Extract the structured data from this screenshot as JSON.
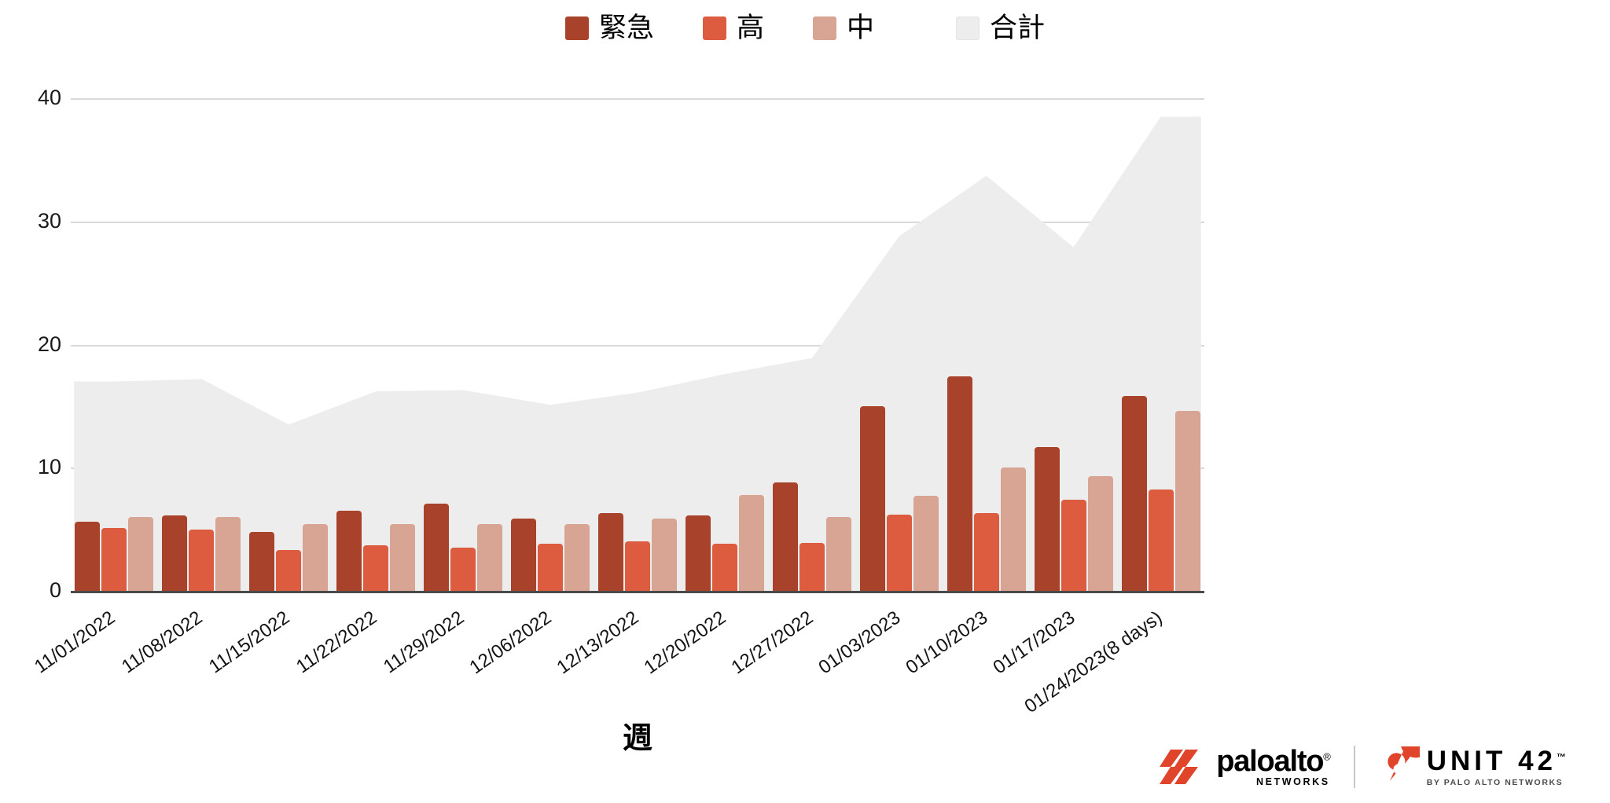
{
  "legend": {
    "items": [
      {
        "label": "緊急",
        "color": "#a8422a",
        "icon": "square-swatch-icon"
      },
      {
        "label": "高",
        "color": "#dd5c3f",
        "icon": "square-swatch-icon"
      },
      {
        "label": "中",
        "color": "#d8a595",
        "icon": "square-swatch-icon"
      },
      {
        "label": "合計",
        "color": "#ededed",
        "icon": "square-swatch-icon"
      }
    ]
  },
  "axes": {
    "y_ticks": [
      "0",
      "10",
      "20",
      "30",
      "40"
    ],
    "x_title": "週"
  },
  "footer": {
    "paloalto": {
      "word": "paloalto",
      "registered": "®",
      "sub": "NETWORKS"
    },
    "unit42": {
      "word": "UNIT 42",
      "tm": "™",
      "sub": "BY PALO ALTO NETWORKS"
    }
  },
  "chart_data": {
    "type": "bar",
    "title": "",
    "subtitle": "",
    "xlabel": "週",
    "ylabel": "",
    "ylim": [
      0,
      40
    ],
    "yticks": [
      0,
      10,
      20,
      30,
      40
    ],
    "grid": true,
    "legend_position": "top-center",
    "categories": [
      "11/01/2022",
      "11/08/2022",
      "11/15/2022",
      "11/22/2022",
      "11/29/2022",
      "12/06/2022",
      "12/13/2022",
      "12/20/2022",
      "12/27/2022",
      "01/03/2023",
      "01/10/2023",
      "01/17/2023",
      "01/24/2023(8 days)"
    ],
    "series": [
      {
        "name": "緊急",
        "type": "bar",
        "color": "#a8422a",
        "values": [
          5.6,
          6.1,
          4.8,
          6.5,
          7.1,
          5.9,
          6.3,
          6.1,
          8.8,
          15.0,
          17.4,
          11.7,
          15.8
        ]
      },
      {
        "name": "高",
        "type": "bar",
        "color": "#dd5c3f",
        "values": [
          5.1,
          5.0,
          3.3,
          3.7,
          3.5,
          3.8,
          4.0,
          3.8,
          3.9,
          6.2,
          6.3,
          7.4,
          8.2
        ]
      },
      {
        "name": "中",
        "type": "bar",
        "color": "#d8a595",
        "values": [
          6.0,
          6.0,
          5.4,
          5.4,
          5.4,
          5.4,
          5.9,
          7.8,
          6.0,
          7.7,
          10.0,
          9.3,
          14.6
        ]
      },
      {
        "name": "合計",
        "type": "area",
        "color": "#ededed",
        "values": [
          17.0,
          17.2,
          13.5,
          16.2,
          16.3,
          15.1,
          16.1,
          17.6,
          18.9,
          28.8,
          33.7,
          27.9,
          38.5
        ]
      }
    ]
  }
}
